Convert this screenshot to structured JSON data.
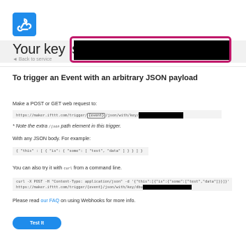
{
  "header": {
    "key_title": "Your key is:",
    "back_link": "◄ Back to service"
  },
  "section": {
    "heading": "To trigger an Event with an arbitrary JSON payload",
    "intro": "Make a POST or GET web request to:",
    "url_prefix": "https://maker.ifttt.com/trigger/",
    "url_event": "{event}",
    "url_suffix": "/json/with/key/",
    "note_prefix": "* Note the extra ",
    "note_code": "/json",
    "note_suffix": " path element in this trigger.",
    "json_intro": "With any JSON body. For example:",
    "json_example": "{ \"this\" : [ { \"is\": { \"some\": [ \"test\", \"data\" ] } } ] }",
    "curl_intro_prefix": "You can also try it with ",
    "curl_intro_code": "curl",
    "curl_intro_suffix": " from a command line.",
    "curl_line1": "curl -X POST -H \"Content-Type: application/json\" -d '{\"this\":[{\"is\":{\"some\":[\"test\",\"data\"]}}]}'",
    "curl_line2": "https://maker.ifttt.com/trigger/{event}/json/with/key/dbu",
    "faq_prefix": "Please read ",
    "faq_link": "our FAQ",
    "faq_suffix": " on using Webhooks for more info."
  },
  "actions": {
    "test_button": "Test It"
  },
  "colors": {
    "accent": "#1f8ceb",
    "highlight": "#c0186a"
  },
  "icons": {
    "logo": "webhooks-logo-icon"
  }
}
